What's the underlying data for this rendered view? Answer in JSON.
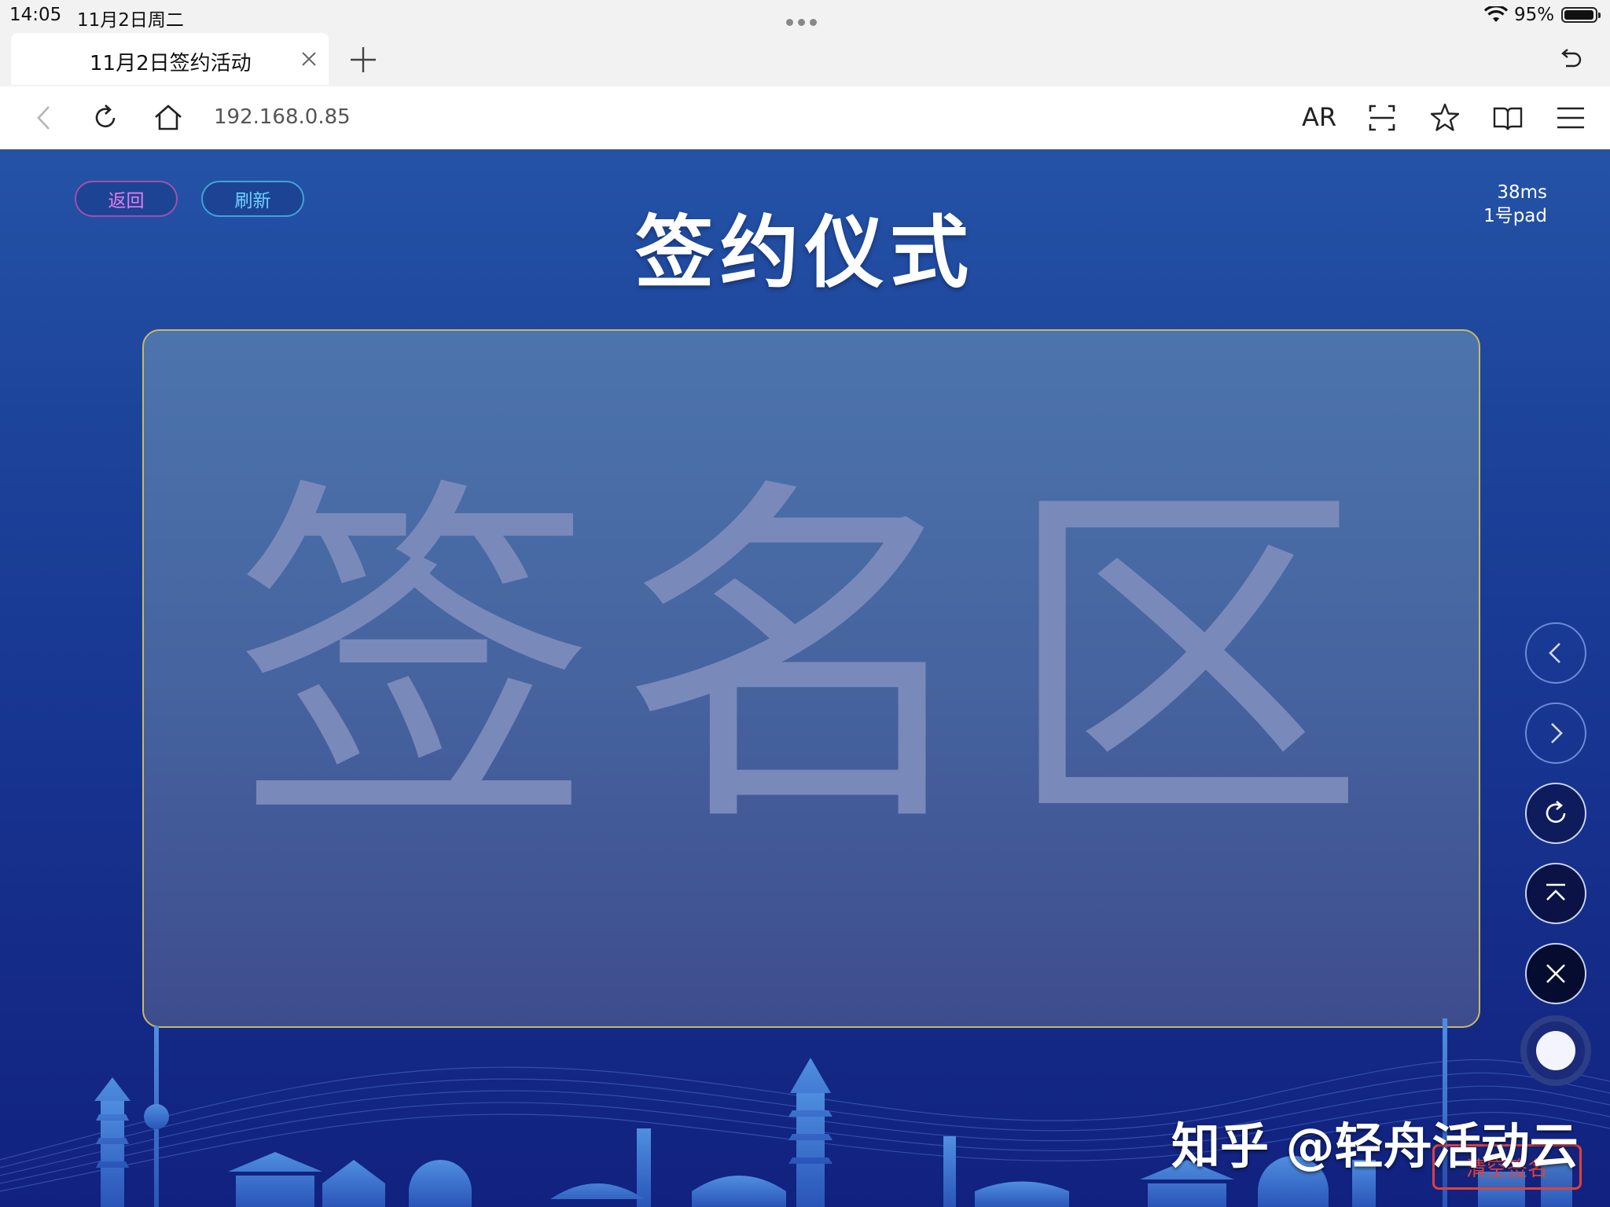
{
  "status_bar": {
    "time": "14:05",
    "date": "11月2日周二",
    "battery_percent": "95%"
  },
  "tabs": {
    "active_title": "11月2日签约活动"
  },
  "address_bar": {
    "url": "192.168.0.85",
    "ar_label": "AR"
  },
  "page": {
    "back_label": "返回",
    "refresh_label": "刷新",
    "title": "签约仪式",
    "latency": "38ms",
    "device": "1号pad",
    "sign_placeholder": "签名区",
    "clear_label": "清空签名",
    "watermark": "知乎 @轻舟活动云"
  },
  "colors": {
    "page_bg": "#1d449b",
    "sign_border": "#c7b96a",
    "back_accent": "#e67cf0",
    "refresh_accent": "#6fd0ff",
    "clear_accent": "#e0413d"
  },
  "icons": [
    "back-icon",
    "reload-icon",
    "home-icon",
    "scan-icon",
    "star-icon",
    "book-icon",
    "menu-icon",
    "prev-icon",
    "next-icon",
    "rotate-icon",
    "top-icon",
    "close-icon",
    "pen-color-icon"
  ]
}
